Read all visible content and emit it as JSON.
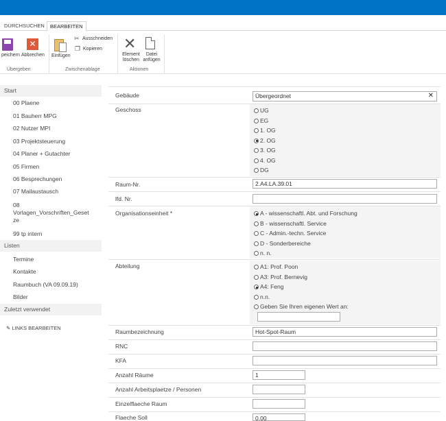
{
  "tabs": [
    "DURCHSUCHEN",
    "BEARBEITEN"
  ],
  "ribbon": {
    "save": "peichern",
    "cancel": "Abbrechen",
    "paste": "Einfügen",
    "cut": "Ausschneiden",
    "copy": "Kopieren",
    "delete_l1": "Element",
    "delete_l2": "löschen",
    "attach_l1": "Datei",
    "attach_l2": "anfügen",
    "groups": [
      "Übergeben",
      "Zwischenablage",
      "Aktionen"
    ]
  },
  "nav": {
    "start": "Start",
    "items": [
      "00 Plaene",
      "01 Bauherr MPG",
      "02 Nutzer MPI",
      "03 Projektsteuerung",
      "04 Planer + Gutachter",
      "05 Firmen",
      "06 Besprechungen",
      "07 Mailaustausch",
      "08",
      "Vorlagen_Vorschriften_Geset",
      "ze",
      "99 tp intern"
    ],
    "lists": "Listen",
    "list_items": [
      "Termine",
      "Kontakte",
      "Raumbuch (VA 09.09.19)",
      "Bilder"
    ],
    "recent": "Zuletzt verwendet",
    "edit_links": "LINKS BEARBEITEN"
  },
  "form": {
    "gebaeude_label": "Gebäude",
    "gebaeude_value": "Übergeordnet",
    "geschoss_label": "Geschoss",
    "geschoss_options": [
      "UG",
      "EG",
      "1. OG",
      "2. OG",
      "3. OG",
      "4. OG",
      "DG"
    ],
    "geschoss_selected": 3,
    "raum_nr_label": "Raum-Nr.",
    "raum_nr_value": "2.A4.LA.39.01",
    "lfd_label": "lfd. Nr.",
    "org_label": "Organisationseinheit *",
    "org_options": [
      "A - wissenschaftl. Abt. und Forschung",
      "B - wissenschaftl. Service",
      "C - Admin.-techn. Service",
      "D - Sonderbereiche",
      "n. n."
    ],
    "org_selected": 0,
    "abteilung_label": "Abteilung",
    "abteilung_options": [
      "A1: Prof. Poon",
      "A3: Prof. Bernevig",
      "A4: Feng",
      "n.n.",
      "Geben Sie Ihren eigenen Wert an:"
    ],
    "abteilung_selected": 2,
    "raumbez_label": "Raumbezeichnung",
    "raumbez_value": "Hot-Spot-Raum",
    "rnc_label": "RNC",
    "kfa_label": "KFA",
    "anzahl_raeume_label": "Anzahl Räume",
    "anzahl_raeume_value": "1",
    "anzahl_ap_label": "Anzahl Arbeitsplaetze / Personen",
    "einzel_label": "Einzelflaeche Raum",
    "flaeche_soll_label": "Flaeche Soll",
    "flaeche_soll_value": "0,00"
  }
}
